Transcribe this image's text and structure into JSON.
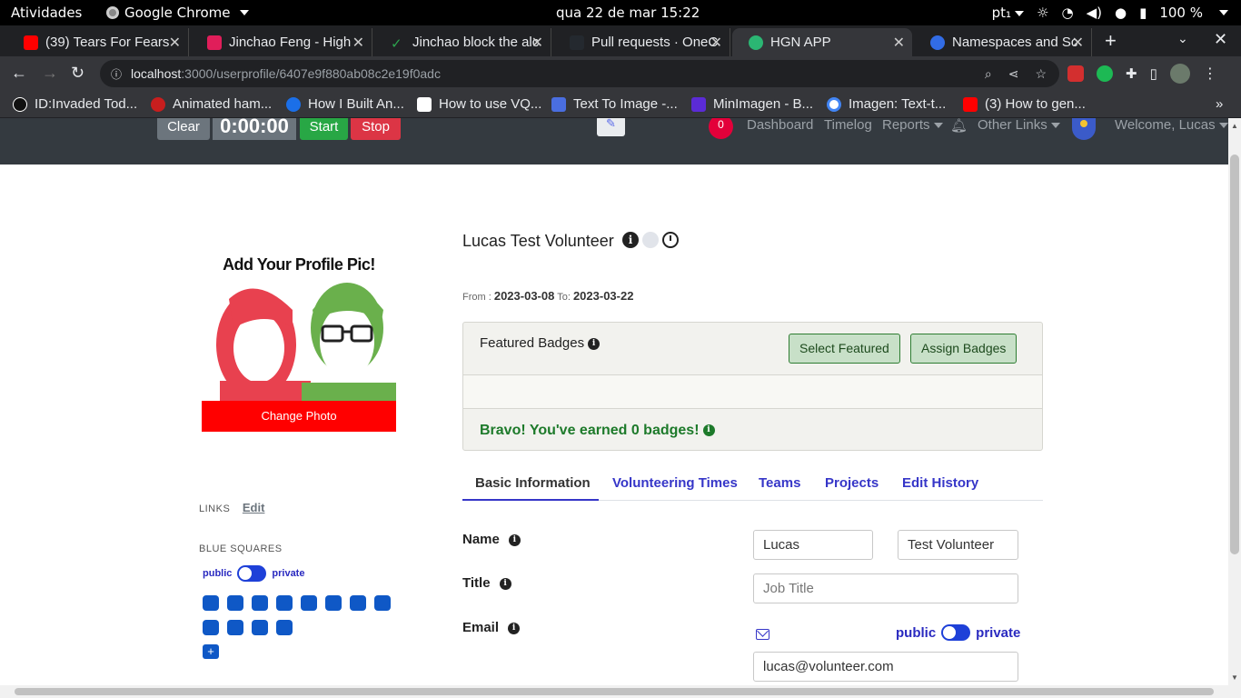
{
  "system": {
    "activities": "Atividades",
    "app_name": "Google Chrome",
    "clock": "qua 22 de mar  15:22",
    "keyboard": "pt₁",
    "battery": "100 %"
  },
  "tabs": [
    {
      "title": "(39) Tears For Fears",
      "color": "#ff0000"
    },
    {
      "title": "Jinchao Feng - High",
      "color": "#e01e5a"
    },
    {
      "title": "Jinchao block the alc",
      "color": "#2da44e"
    },
    {
      "title": "Pull requests · OneC",
      "color": "#24292f"
    },
    {
      "title": "HGN APP",
      "color": "#2bb673"
    },
    {
      "title": "Namespaces and Sc",
      "color": "#326ce5"
    }
  ],
  "url": {
    "host": "localhost",
    "path": ":3000/userprofile/6407e9f880ab08c2e19f0adc"
  },
  "bookmarks": [
    {
      "title": "ID:Invaded Tod...",
      "color": "#111111"
    },
    {
      "title": "Animated ham...",
      "color": "#c81e1e"
    },
    {
      "title": "How I Built An...",
      "color": "#1b6fe8"
    },
    {
      "title": "How to use VQ...",
      "color": "#000000"
    },
    {
      "title": "Text To Image -...",
      "color": "#4a6ee0"
    },
    {
      "title": "MinImagen - B...",
      "color": "#5b2bd6"
    },
    {
      "title": "Imagen: Text-t...",
      "color": "#4285f4"
    },
    {
      "title": "(3) How to gen...",
      "color": "#ff0000"
    }
  ],
  "header": {
    "clear": "Clear",
    "timer": "0:00:00",
    "start": "Start",
    "stop": "Stop",
    "notifications": "0",
    "dashboard": "Dashboard",
    "timelog": "Timelog",
    "reports": "Reports",
    "other_links": "Other Links",
    "welcome": "Welcome, Lucas"
  },
  "profile": {
    "pic_title": "Add Your Profile Pic!",
    "change_photo": "Change Photo",
    "links_label": "LINKS",
    "links_edit": "Edit",
    "blue_squares_label": "BLUE SQUARES",
    "public": "public",
    "private": "private",
    "blue_square_count": 12,
    "add": "+",
    "name": "Lucas Test Volunteer",
    "from_label": "From :",
    "from_date": "2023-03-08",
    "to_label": "To:",
    "to_date": "2023-03-22"
  },
  "badges": {
    "title": "Featured Badges",
    "select_featured": "Select Featured",
    "assign_badges": "Assign Badges",
    "bravo": "Bravo! You've earned 0 badges!"
  },
  "profile_tabs": [
    "Basic Information",
    "Volunteering Times",
    "Teams",
    "Projects",
    "Edit History"
  ],
  "fields": {
    "name_label": "Name",
    "first_name": "Lucas",
    "last_name": "Test Volunteer",
    "title_label": "Title",
    "title_placeholder": "Job Title",
    "email_label": "Email",
    "email": "lucas@volunteer.com",
    "email_public": "public",
    "email_private": "private"
  }
}
